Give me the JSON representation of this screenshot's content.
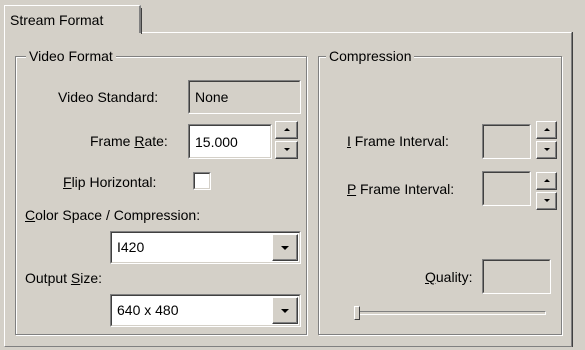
{
  "tab": {
    "label": "Stream Format"
  },
  "video_format": {
    "title": "Video Format",
    "video_standard": {
      "label": "Video Standard:",
      "value": "None"
    },
    "frame_rate": {
      "label_pre": "Frame ",
      "label_u": "R",
      "label_post": "ate:",
      "value": "15.000"
    },
    "flip_horizontal": {
      "label_u": "F",
      "label_post": "lip Horizontal:",
      "checked": false
    },
    "color_space": {
      "label_u": "C",
      "label_post": "olor Space / Compression:",
      "value": "I420"
    },
    "output_size": {
      "label_pre": "Output ",
      "label_u": "S",
      "label_post": "ize:",
      "value": "640 x 480"
    }
  },
  "compression": {
    "title": "Compression",
    "i_frame": {
      "label_u": "I",
      "label_post": " Frame Interval:",
      "value": ""
    },
    "p_frame": {
      "label_u": "P",
      "label_post": " Frame Interval:",
      "value": ""
    },
    "quality": {
      "label_u": "Q",
      "label_post": "uality:",
      "value": ""
    },
    "quality_slider_level": 0
  },
  "icons": {
    "spin_up": "arrow-up",
    "spin_down": "arrow-down",
    "dropdown": "arrow-down"
  }
}
